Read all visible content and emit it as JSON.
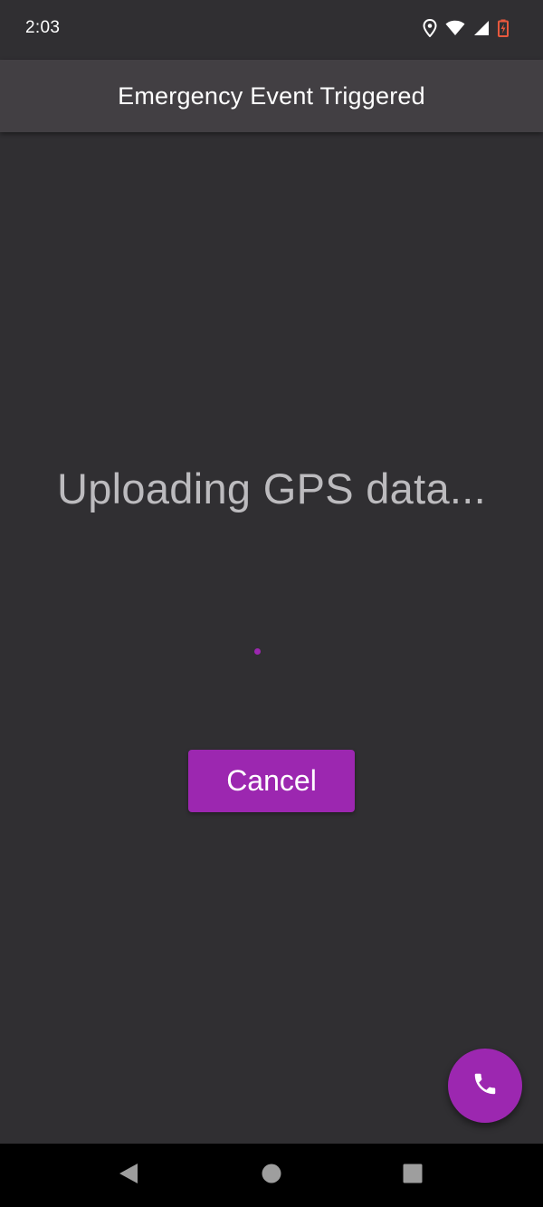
{
  "status_bar": {
    "time": "2:03",
    "icons": [
      "location-icon",
      "wifi-icon",
      "cell-signal-icon",
      "battery-charging-icon"
    ],
    "battery_color": "#e8583d"
  },
  "app_bar": {
    "title": "Emergency Event Triggered"
  },
  "main": {
    "status_message": "Uploading GPS data...",
    "progress_indicator": "loading-spinner",
    "cancel_label": "Cancel"
  },
  "fab": {
    "icon": "phone-icon"
  },
  "navigation": {
    "buttons": [
      "back-icon",
      "home-icon",
      "recents-icon"
    ]
  },
  "colors": {
    "accent": "#9c27b0",
    "background": "#302f32",
    "app_bar": "#423f43",
    "status_text": "#bcbbbe"
  }
}
